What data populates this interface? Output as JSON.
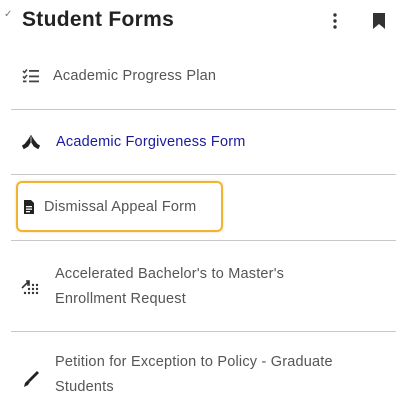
{
  "header": {
    "collapse_glyph": "✓",
    "title": "Student Forms"
  },
  "items": [
    {
      "label": "Academic Progress Plan",
      "icon": "checklist-icon"
    },
    {
      "label": "Academic Forgiveness Form",
      "icon": "praying-hands-icon"
    },
    {
      "label": "Dismissal Appeal Form",
      "icon": "document-icon"
    },
    {
      "label": "Accelerated Bachelor's to Master's Enrollment Request",
      "line1": "Accelerated Bachelor's to Master's",
      "line2": "Enrollment Request",
      "icon": "fast-forward-grid-icon"
    },
    {
      "label": "Petition for Exception to Policy - Graduate Students",
      "line1": "Petition for Exception to Policy - Graduate",
      "line2": "Students",
      "icon": "pen-icon"
    }
  ],
  "colors": {
    "title": "#222222",
    "text": "#555555",
    "link": "#1a1aa0",
    "focus_border": "#f2b233",
    "divider": "#c8c8c8"
  }
}
